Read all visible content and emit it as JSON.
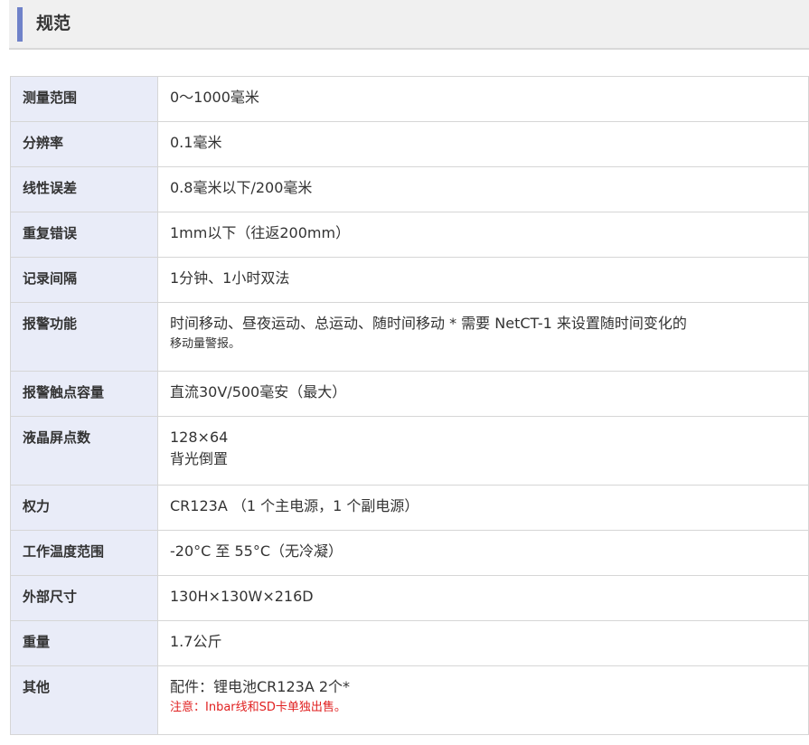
{
  "header": {
    "title": "规范",
    "accent_color": "#6f82c9"
  },
  "rows": [
    {
      "label": "测量范围",
      "lines": [
        "0～1000毫米"
      ]
    },
    {
      "label": "分辨率",
      "lines": [
        "0.1毫米"
      ]
    },
    {
      "label": "线性误差",
      "lines": [
        "0.8毫米以下/200毫米"
      ]
    },
    {
      "label": "重复错误",
      "lines": [
        "1mm以下（往返200mm）"
      ]
    },
    {
      "label": "记录间隔",
      "lines": [
        "1分钟、1小时双法"
      ]
    },
    {
      "label": "报警功能",
      "lines": [
        "时间移动、昼夜运动、总运动、随时间移动 * 需要 NetCT-1 来设置随时间变化的"
      ],
      "small": "移动量警报。"
    },
    {
      "label": "报警触点容量",
      "lines": [
        "直流30V/500毫安（最大）"
      ]
    },
    {
      "label": "液晶屏点数",
      "lines": [
        "128×64",
        "背光倒置"
      ]
    },
    {
      "label": "权力",
      "lines": [
        "CR123A （1 个主电源，1 个副电源）"
      ]
    },
    {
      "label": "工作温度范围",
      "lines": [
        "-20°C 至 55°C（无冷凝）"
      ]
    },
    {
      "label": "外部尺寸",
      "lines": [
        "130H×130W×216D"
      ]
    },
    {
      "label": "重量",
      "lines": [
        "1.7公斤"
      ]
    },
    {
      "label": "其他",
      "lines": [
        "配件：锂电池CR123A 2个*"
      ],
      "note": "注意：Inbar线和SD卡单独出售。",
      "note_color": "#e02020"
    }
  ]
}
